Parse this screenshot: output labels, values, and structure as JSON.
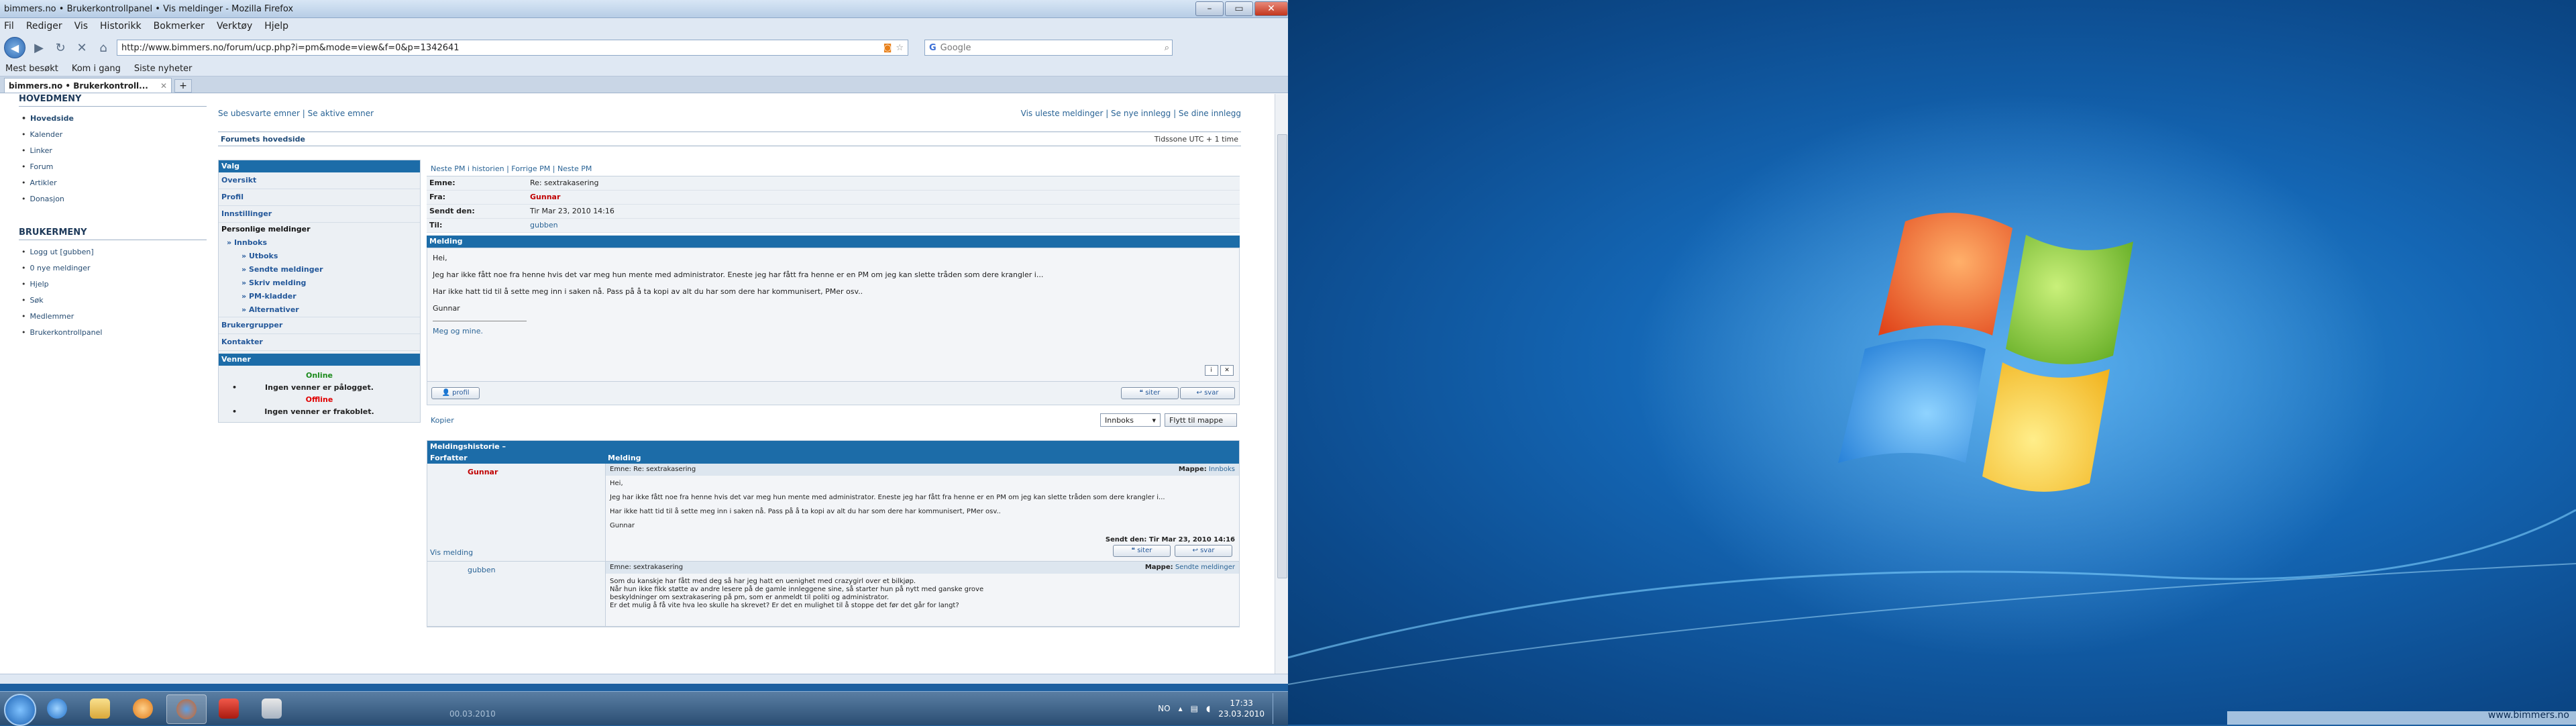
{
  "window": {
    "title": "bimmers.no • Brukerkontrollpanel • Vis meldinger - Mozilla Firefox"
  },
  "menu": [
    "Fil",
    "Rediger",
    "Vis",
    "Historikk",
    "Bokmerker",
    "Verktøy",
    "Hjelp"
  ],
  "nav": {
    "url": "http://www.bimmers.no/forum/ucp.php?i=pm&mode=view&f=0&p=1342641",
    "search_placeholder": "Google"
  },
  "bookmarks": [
    "Mest besøkt",
    "Kom i gang",
    "Siste nyheter"
  ],
  "tab": {
    "label": "bimmers.no • Brukerkontroll...",
    "new": "+"
  },
  "left": {
    "main_heading": "HOVEDMENY",
    "main_items": [
      "Hovedside",
      "Kalender",
      "Linker",
      "Forum",
      "Artikler",
      "Donasjon"
    ],
    "user_heading": "BRUKERMENY",
    "user_items": [
      "Logg ut [gubben]",
      "0 nye meldinger",
      "Hjelp",
      "Søk",
      "Medlemmer",
      "Brukerkontrollpanel"
    ]
  },
  "toplinks": {
    "left": "Se ubesvarte emner | Se aktive emner",
    "right": "Vis uleste meldinger | Se nye innlegg | Se dine innlegg"
  },
  "forumbar": {
    "index": "Forumets hovedside",
    "tz": "Tidssone UTC + 1 time"
  },
  "ucp": {
    "head": "Valg",
    "items": [
      "Oversikt",
      "Profil",
      "Innstillinger"
    ],
    "pm_title": "Personlige meldinger",
    "pm_items": [
      "Innboks",
      "Utboks",
      "Sendte meldinger",
      "Skriv melding",
      "PM-kladder",
      "Alternativer"
    ],
    "extra": [
      "Brukergrupper",
      "Kontakter"
    ],
    "friends_head": "Venner",
    "online": "Online",
    "online_none": "Ingen venner er pålogget.",
    "offline": "Offline",
    "offline_none": "Ingen venner er frakoblet."
  },
  "pm": {
    "links": "Neste PM i historien | Forrige PM | Neste PM",
    "subject_k": "Emne:",
    "subject_v": "Re: sextrakasering",
    "from_k": "Fra:",
    "from_v": "Gunnar",
    "sent_k": "Sendt den:",
    "sent_v": "Tir Mar 23, 2010 14:16",
    "to_k": "Til:",
    "to_v": "gubben",
    "msg_head": "Melding",
    "body": [
      "Hei,",
      "Jeg har ikke fått noe fra henne hvis det var meg hun mente med administrator. Eneste jeg har fått fra henne er en PM om jeg kan slette tråden som dere krangler i...",
      "Har ikke hatt tid til å sette meg inn i saken nå. Pass på å ta kopi av alt du har som dere har kommunisert, PMer osv..",
      "Gunnar"
    ],
    "signature": "Meg og mine.",
    "profile_btn": "profil",
    "quote_btn": "siter",
    "reply_btn": "svar",
    "copy": "Kopier",
    "folder": "Innboks",
    "move": "Flytt til mappe"
  },
  "history": {
    "title": "Meldingshistorie",
    "col_author": "Forfatter",
    "col_msg": "Melding",
    "rows": [
      {
        "author": "Gunnar",
        "subject": "Emne: Re: sextrakasering",
        "folder_k": "Mappe:",
        "folder_v": "Innboks",
        "body": [
          "Hei,",
          "Jeg har ikke fått noe fra henne hvis det var meg hun mente med administrator. Eneste jeg har fått fra henne er en PM om jeg kan slette tråden som dere krangler i...",
          "Har ikke hatt tid til å sette meg inn i saken nå. Pass på å ta kopi av alt du har som dere har kommunisert, PMer osv..",
          "Gunnar"
        ],
        "sent": "Sendt den: Tir Mar 23, 2010 14:16",
        "view": "Vis melding"
      },
      {
        "author": "gubben",
        "subject": "Emne: sextrakasering",
        "folder_k": "Mappe:",
        "folder_v": "Sendte meldinger",
        "body": [
          "Som du kanskje har fått med deg så har jeg hatt en uenighet med crazygirl over et bilkjøp.",
          "Når hun ikke fikk støtte av andre lesere på de gamle innleggene sine, så starter hun på nytt med ganske grove",
          "beskyldninger om sextrakasering på pm, som er anmeldt til politi og administrator.",
          "Er det mulig å få vite hva leo skulle ha skrevet? Er det en mulighet til å stoppe det før det går for langt?"
        ]
      }
    ]
  },
  "taskbar": {
    "lang": "NO",
    "time": "17:33",
    "date": "23.03.2010",
    "ghost": "00.03.2010"
  },
  "desktop": {
    "watermark": "www.bimmers.no"
  }
}
